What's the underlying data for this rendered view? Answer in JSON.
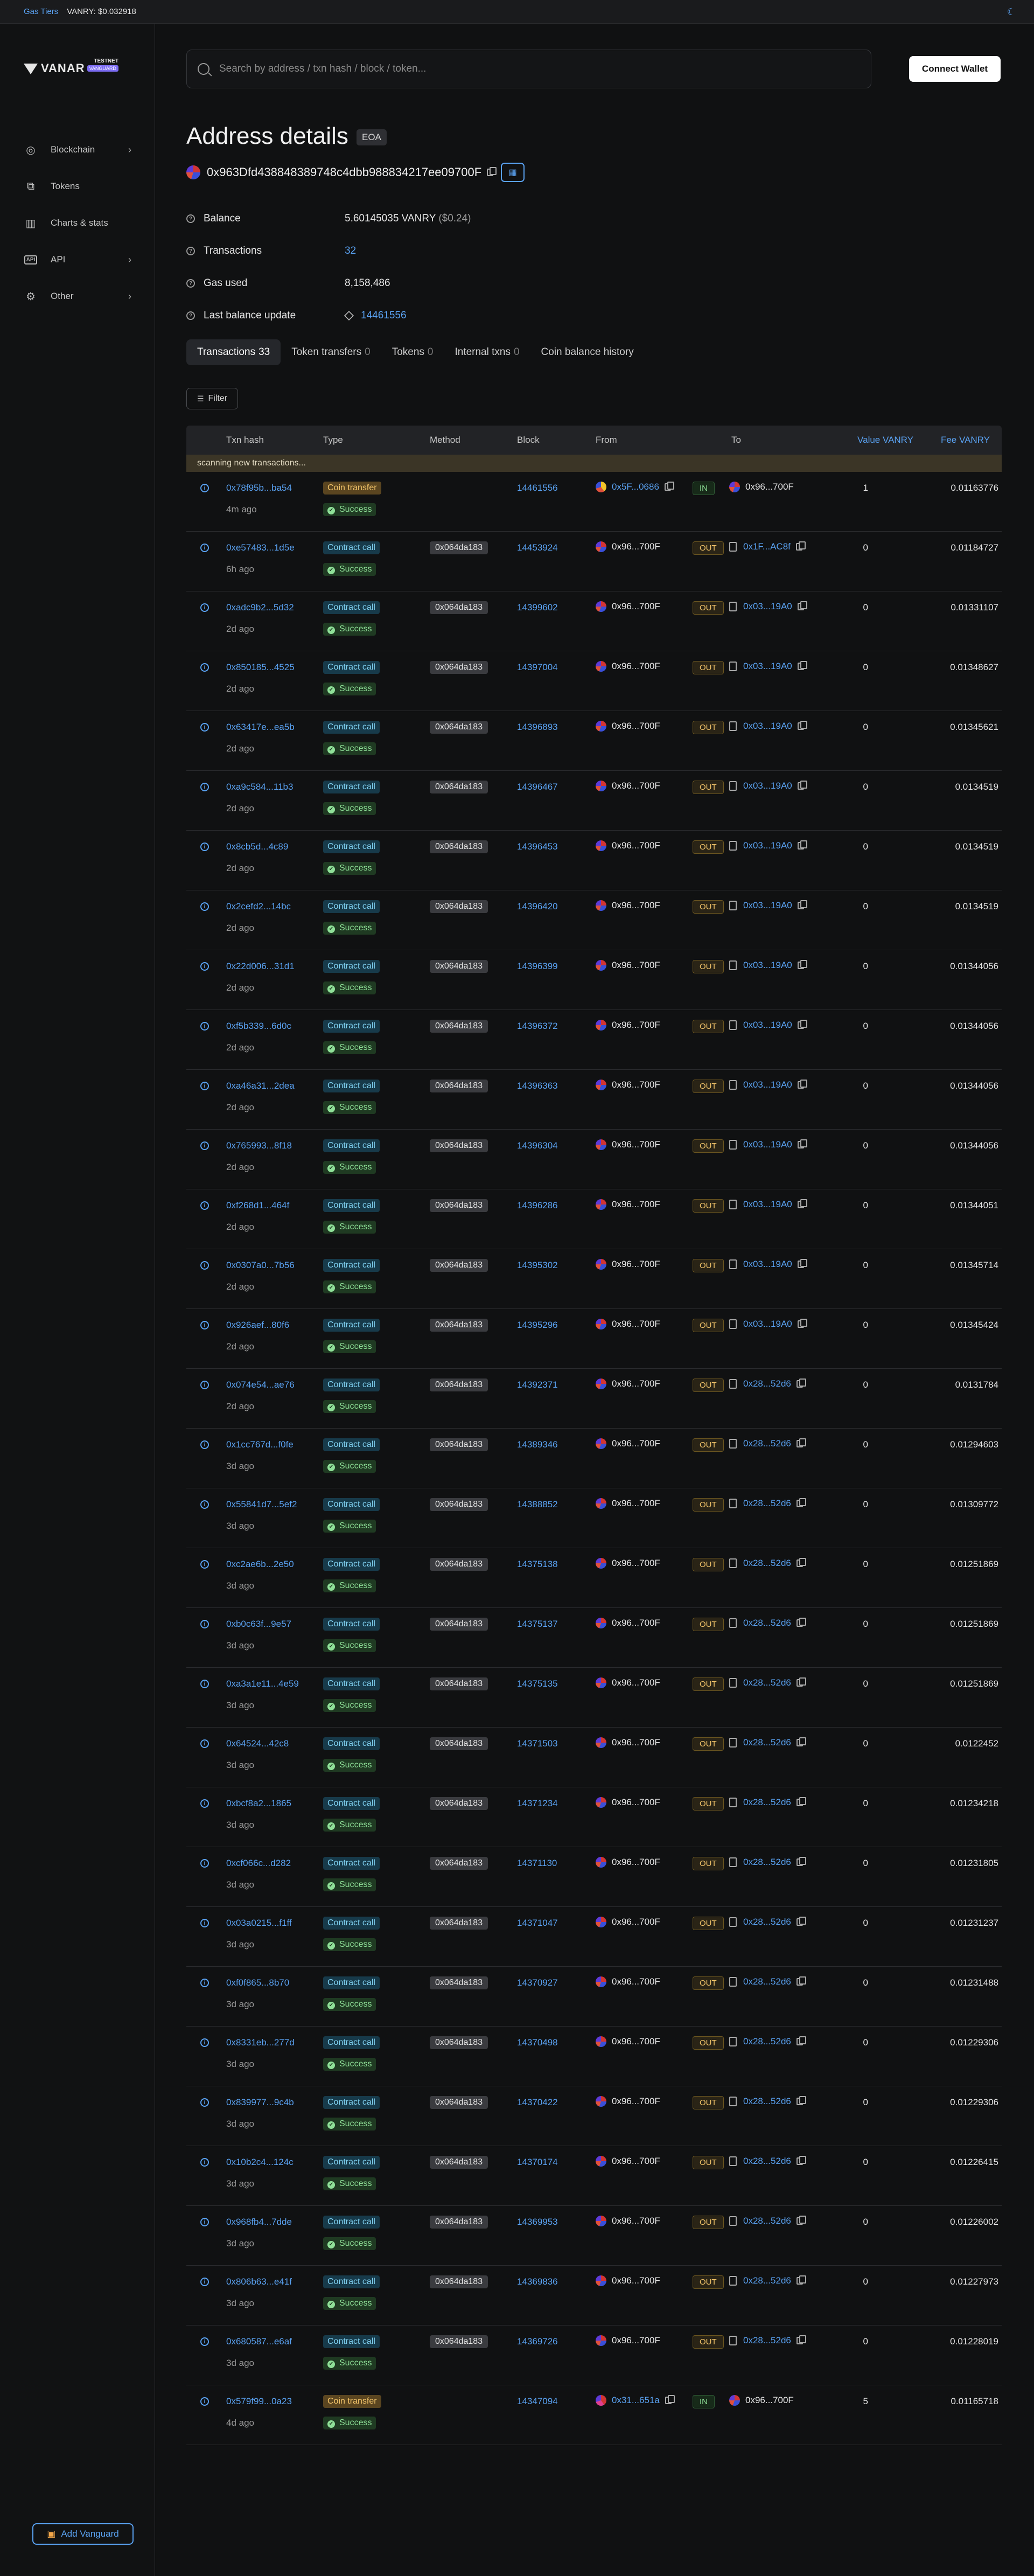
{
  "topbar": {
    "gas_label": "Gas Tiers",
    "price": "VANRY: $0.032918"
  },
  "logo": {
    "text": "VANAR",
    "testnet": "TESTNET",
    "vanguard": "VANGUARD"
  },
  "sidebar": {
    "items": [
      {
        "label": "Blockchain",
        "icon": "globe-icon",
        "chevron": "›"
      },
      {
        "label": "Tokens",
        "icon": "tokens-icon",
        "chevron": ""
      },
      {
        "label": "Charts & stats",
        "icon": "chart-icon",
        "chevron": ""
      },
      {
        "label": "API",
        "icon": "api-icon",
        "chevron": "›"
      },
      {
        "label": "Other",
        "icon": "gear-icon",
        "chevron": "›"
      }
    ],
    "vanguard_button": "Add Vanguard"
  },
  "search": {
    "placeholder": "Search by address / txn hash / block / token..."
  },
  "connect_label": "Connect Wallet",
  "page": {
    "title": "Address details",
    "badge": "EOA",
    "address": "0x963Dfd438848389748c4dbb988834217ee09700F"
  },
  "info": {
    "balance_label": "Balance",
    "balance_value": "5.60145035 VANRY",
    "balance_usd": "($0.24)",
    "tx_label": "Transactions",
    "tx_value": "32",
    "gas_label": "Gas used",
    "gas_value": "8,158,486",
    "last_label": "Last balance update",
    "last_value": "14461556"
  },
  "tabs": [
    {
      "label": "Transactions",
      "count": "33"
    },
    {
      "label": "Token transfers",
      "count": "0"
    },
    {
      "label": "Tokens",
      "count": "0"
    },
    {
      "label": "Internal txns",
      "count": "0"
    },
    {
      "label": "Coin balance history",
      "count": ""
    }
  ],
  "filter_label": "Filter",
  "table": {
    "headers": {
      "hash": "Txn hash",
      "type": "Type",
      "method": "Method",
      "block": "Block",
      "from": "From",
      "to": "To",
      "value": "Value VANRY",
      "fee": "Fee VANRY"
    },
    "scanning": "scanning new transactions...",
    "status": "Success",
    "rows": [
      {
        "hash": "0x78f95b...ba54",
        "age": "4m ago",
        "type": "Coin transfer",
        "method": "",
        "block": "14461556",
        "from": "0x5F...0686",
        "dir": "IN",
        "to": "0x96...700F",
        "value": "1",
        "fee": "0.01163776"
      },
      {
        "hash": "0xe57483...1d5e",
        "age": "6h ago",
        "type": "Contract call",
        "method": "0x064da183",
        "block": "14453924",
        "from": "0x96...700F",
        "dir": "OUT",
        "to": "0x1F...AC8f",
        "value": "0",
        "fee": "0.01184727"
      },
      {
        "hash": "0xadc9b2...5d32",
        "age": "2d ago",
        "type": "Contract call",
        "method": "0x064da183",
        "block": "14399602",
        "from": "0x96...700F",
        "dir": "OUT",
        "to": "0x03...19A0",
        "value": "0",
        "fee": "0.01331107"
      },
      {
        "hash": "0x850185...4525",
        "age": "2d ago",
        "type": "Contract call",
        "method": "0x064da183",
        "block": "14397004",
        "from": "0x96...700F",
        "dir": "OUT",
        "to": "0x03...19A0",
        "value": "0",
        "fee": "0.01348627"
      },
      {
        "hash": "0x63417e...ea5b",
        "age": "2d ago",
        "type": "Contract call",
        "method": "0x064da183",
        "block": "14396893",
        "from": "0x96...700F",
        "dir": "OUT",
        "to": "0x03...19A0",
        "value": "0",
        "fee": "0.01345621"
      },
      {
        "hash": "0xa9c584...11b3",
        "age": "2d ago",
        "type": "Contract call",
        "method": "0x064da183",
        "block": "14396467",
        "from": "0x96...700F",
        "dir": "OUT",
        "to": "0x03...19A0",
        "value": "0",
        "fee": "0.0134519"
      },
      {
        "hash": "0x8cb5d...4c89",
        "age": "2d ago",
        "type": "Contract call",
        "method": "0x064da183",
        "block": "14396453",
        "from": "0x96...700F",
        "dir": "OUT",
        "to": "0x03...19A0",
        "value": "0",
        "fee": "0.0134519"
      },
      {
        "hash": "0x2cefd2...14bc",
        "age": "2d ago",
        "type": "Contract call",
        "method": "0x064da183",
        "block": "14396420",
        "from": "0x96...700F",
        "dir": "OUT",
        "to": "0x03...19A0",
        "value": "0",
        "fee": "0.0134519"
      },
      {
        "hash": "0x22d006...31d1",
        "age": "2d ago",
        "type": "Contract call",
        "method": "0x064da183",
        "block": "14396399",
        "from": "0x96...700F",
        "dir": "OUT",
        "to": "0x03...19A0",
        "value": "0",
        "fee": "0.01344056"
      },
      {
        "hash": "0xf5b339...6d0c",
        "age": "2d ago",
        "type": "Contract call",
        "method": "0x064da183",
        "block": "14396372",
        "from": "0x96...700F",
        "dir": "OUT",
        "to": "0x03...19A0",
        "value": "0",
        "fee": "0.01344056"
      },
      {
        "hash": "0xa46a31...2dea",
        "age": "2d ago",
        "type": "Contract call",
        "method": "0x064da183",
        "block": "14396363",
        "from": "0x96...700F",
        "dir": "OUT",
        "to": "0x03...19A0",
        "value": "0",
        "fee": "0.01344056"
      },
      {
        "hash": "0x765993...8f18",
        "age": "2d ago",
        "type": "Contract call",
        "method": "0x064da183",
        "block": "14396304",
        "from": "0x96...700F",
        "dir": "OUT",
        "to": "0x03...19A0",
        "value": "0",
        "fee": "0.01344056"
      },
      {
        "hash": "0xf268d1...464f",
        "age": "2d ago",
        "type": "Contract call",
        "method": "0x064da183",
        "block": "14396286",
        "from": "0x96...700F",
        "dir": "OUT",
        "to": "0x03...19A0",
        "value": "0",
        "fee": "0.01344051"
      },
      {
        "hash": "0x0307a0...7b56",
        "age": "2d ago",
        "type": "Contract call",
        "method": "0x064da183",
        "block": "14395302",
        "from": "0x96...700F",
        "dir": "OUT",
        "to": "0x03...19A0",
        "value": "0",
        "fee": "0.01345714"
      },
      {
        "hash": "0x926aef...80f6",
        "age": "2d ago",
        "type": "Contract call",
        "method": "0x064da183",
        "block": "14395296",
        "from": "0x96...700F",
        "dir": "OUT",
        "to": "0x03...19A0",
        "value": "0",
        "fee": "0.01345424"
      },
      {
        "hash": "0x074e54...ae76",
        "age": "2d ago",
        "type": "Contract call",
        "method": "0x064da183",
        "block": "14392371",
        "from": "0x96...700F",
        "dir": "OUT",
        "to": "0x28...52d6",
        "value": "0",
        "fee": "0.0131784"
      },
      {
        "hash": "0x1cc767d...f0fe",
        "age": "3d ago",
        "type": "Contract call",
        "method": "0x064da183",
        "block": "14389346",
        "from": "0x96...700F",
        "dir": "OUT",
        "to": "0x28...52d6",
        "value": "0",
        "fee": "0.01294603"
      },
      {
        "hash": "0x55841d7...5ef2",
        "age": "3d ago",
        "type": "Contract call",
        "method": "0x064da183",
        "block": "14388852",
        "from": "0x96...700F",
        "dir": "OUT",
        "to": "0x28...52d6",
        "value": "0",
        "fee": "0.01309772"
      },
      {
        "hash": "0xc2ae6b...2e50",
        "age": "3d ago",
        "type": "Contract call",
        "method": "0x064da183",
        "block": "14375138",
        "from": "0x96...700F",
        "dir": "OUT",
        "to": "0x28...52d6",
        "value": "0",
        "fee": "0.01251869"
      },
      {
        "hash": "0xb0c63f...9e57",
        "age": "3d ago",
        "type": "Contract call",
        "method": "0x064da183",
        "block": "14375137",
        "from": "0x96...700F",
        "dir": "OUT",
        "to": "0x28...52d6",
        "value": "0",
        "fee": "0.01251869"
      },
      {
        "hash": "0xa3a1e11...4e59",
        "age": "3d ago",
        "type": "Contract call",
        "method": "0x064da183",
        "block": "14375135",
        "from": "0x96...700F",
        "dir": "OUT",
        "to": "0x28...52d6",
        "value": "0",
        "fee": "0.01251869"
      },
      {
        "hash": "0x64524...42c8",
        "age": "3d ago",
        "type": "Contract call",
        "method": "0x064da183",
        "block": "14371503",
        "from": "0x96...700F",
        "dir": "OUT",
        "to": "0x28...52d6",
        "value": "0",
        "fee": "0.0122452"
      },
      {
        "hash": "0xbcf8a2...1865",
        "age": "3d ago",
        "type": "Contract call",
        "method": "0x064da183",
        "block": "14371234",
        "from": "0x96...700F",
        "dir": "OUT",
        "to": "0x28...52d6",
        "value": "0",
        "fee": "0.01234218"
      },
      {
        "hash": "0xcf066c...d282",
        "age": "3d ago",
        "type": "Contract call",
        "method": "0x064da183",
        "block": "14371130",
        "from": "0x96...700F",
        "dir": "OUT",
        "to": "0x28...52d6",
        "value": "0",
        "fee": "0.01231805"
      },
      {
        "hash": "0x03a0215...f1ff",
        "age": "3d ago",
        "type": "Contract call",
        "method": "0x064da183",
        "block": "14371047",
        "from": "0x96...700F",
        "dir": "OUT",
        "to": "0x28...52d6",
        "value": "0",
        "fee": "0.01231237"
      },
      {
        "hash": "0xf0f865...8b70",
        "age": "3d ago",
        "type": "Contract call",
        "method": "0x064da183",
        "block": "14370927",
        "from": "0x96...700F",
        "dir": "OUT",
        "to": "0x28...52d6",
        "value": "0",
        "fee": "0.01231488"
      },
      {
        "hash": "0x8331eb...277d",
        "age": "3d ago",
        "type": "Contract call",
        "method": "0x064da183",
        "block": "14370498",
        "from": "0x96...700F",
        "dir": "OUT",
        "to": "0x28...52d6",
        "value": "0",
        "fee": "0.01229306"
      },
      {
        "hash": "0x839977...9c4b",
        "age": "3d ago",
        "type": "Contract call",
        "method": "0x064da183",
        "block": "14370422",
        "from": "0x96...700F",
        "dir": "OUT",
        "to": "0x28...52d6",
        "value": "0",
        "fee": "0.01229306"
      },
      {
        "hash": "0x10b2c4...124c",
        "age": "3d ago",
        "type": "Contract call",
        "method": "0x064da183",
        "block": "14370174",
        "from": "0x96...700F",
        "dir": "OUT",
        "to": "0x28...52d6",
        "value": "0",
        "fee": "0.01226415"
      },
      {
        "hash": "0x968fb4...7dde",
        "age": "3d ago",
        "type": "Contract call",
        "method": "0x064da183",
        "block": "14369953",
        "from": "0x96...700F",
        "dir": "OUT",
        "to": "0x28...52d6",
        "value": "0",
        "fee": "0.01226002"
      },
      {
        "hash": "0x806b63...e41f",
        "age": "3d ago",
        "type": "Contract call",
        "method": "0x064da183",
        "block": "14369836",
        "from": "0x96...700F",
        "dir": "OUT",
        "to": "0x28...52d6",
        "value": "0",
        "fee": "0.01227973"
      },
      {
        "hash": "0x680587...e6af",
        "age": "3d ago",
        "type": "Contract call",
        "method": "0x064da183",
        "block": "14369726",
        "from": "0x96...700F",
        "dir": "OUT",
        "to": "0x28...52d6",
        "value": "0",
        "fee": "0.01228019"
      },
      {
        "hash": "0x579f99...0a23",
        "age": "4d ago",
        "type": "Coin transfer",
        "method": "",
        "block": "14347094",
        "from": "0x31...651a",
        "dir": "IN",
        "to": "0x96...700F",
        "value": "5",
        "fee": "0.01165718"
      }
    ]
  }
}
